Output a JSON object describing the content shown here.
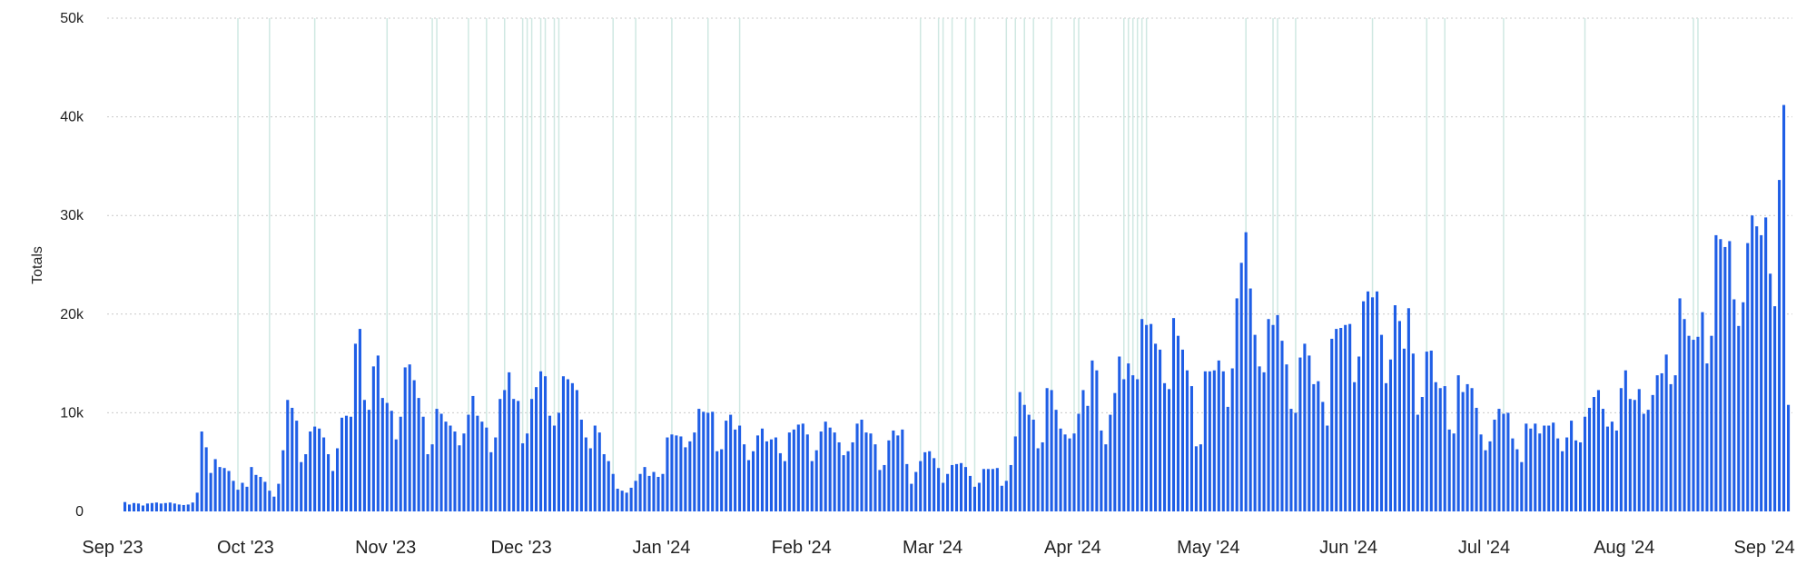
{
  "chart_data": {
    "type": "bar",
    "title": "",
    "xlabel": "",
    "ylabel": "Totals",
    "ylim": [
      0,
      50000
    ],
    "grid": true,
    "bar_color": "#1f5ee6",
    "event_line_color": "#cfe8e2",
    "y_ticks": [
      {
        "value": 0,
        "label": "0"
      },
      {
        "value": 10000,
        "label": "10k"
      },
      {
        "value": 20000,
        "label": "20k"
      },
      {
        "value": 30000,
        "label": "30k"
      },
      {
        "value": 40000,
        "label": "40k"
      },
      {
        "value": 50000,
        "label": "50k"
      }
    ],
    "x_ticks": [
      {
        "date": "2023-09-01",
        "label": "Sep '23"
      },
      {
        "date": "2023-10-01",
        "label": "Oct '23"
      },
      {
        "date": "2023-11-01",
        "label": "Nov '23"
      },
      {
        "date": "2023-12-01",
        "label": "Dec '23"
      },
      {
        "date": "2024-01-01",
        "label": "Jan '24"
      },
      {
        "date": "2024-02-01",
        "label": "Feb '24"
      },
      {
        "date": "2024-03-01",
        "label": "Mar '24"
      },
      {
        "date": "2024-04-01",
        "label": "Apr '24"
      },
      {
        "date": "2024-05-01",
        "label": "May '24"
      },
      {
        "date": "2024-06-01",
        "label": "Jun '24"
      },
      {
        "date": "2024-07-01",
        "label": "Jul '24"
      },
      {
        "date": "2024-08-01",
        "label": "Aug '24"
      },
      {
        "date": "2024-09-01",
        "label": "Sep '24"
      }
    ],
    "event_dates": [
      "2023-09-29",
      "2023-10-06",
      "2023-10-16",
      "2023-11-01",
      "2023-11-11",
      "2023-11-12",
      "2023-11-19",
      "2023-11-23",
      "2023-11-27",
      "2023-12-01",
      "2023-12-02",
      "2023-12-03",
      "2023-12-05",
      "2023-12-06",
      "2023-12-08",
      "2023-12-09",
      "2023-12-21",
      "2023-12-26",
      "2024-01-03",
      "2024-01-11",
      "2024-01-18",
      "2024-02-27",
      "2024-03-02",
      "2024-03-03",
      "2024-03-05",
      "2024-03-08",
      "2024-03-10",
      "2024-03-17",
      "2024-03-19",
      "2024-03-21",
      "2024-03-23",
      "2024-03-27",
      "2024-04-01",
      "2024-04-02",
      "2024-04-12",
      "2024-04-13",
      "2024-04-14",
      "2024-04-15",
      "2024-04-16",
      "2024-04-17",
      "2024-05-09",
      "2024-05-15",
      "2024-05-16",
      "2024-05-20",
      "2024-06-06",
      "2024-06-18",
      "2024-06-22",
      "2024-07-05",
      "2024-07-23",
      "2024-08-16",
      "2024-08-17"
    ],
    "series": [
      {
        "start": "2023-09-04",
        "values": [
          950,
          700,
          850,
          800,
          600,
          800,
          850,
          900,
          800,
          850,
          900,
          800,
          700,
          650,
          700,
          900,
          1900,
          8100,
          6500,
          3900,
          5300,
          4500,
          4400,
          4100,
          3100,
          2200,
          2900,
          2500,
          4500,
          3700,
          3500,
          3000,
          2100,
          1500,
          2800,
          6200,
          11300,
          10500,
          9200,
          5000,
          5800,
          8100,
          8600,
          8400,
          7500,
          5800,
          4100,
          6400,
          9500,
          9700,
          9600,
          17000,
          18500,
          11300,
          10300,
          14700,
          15800,
          11500,
          11000,
          10200,
          7300,
          9600,
          14600,
          14900,
          13300,
          11500,
          9600,
          5800,
          6800,
          10400,
          9900,
          9100,
          8700,
          8100,
          6700,
          7900,
          9800,
          11700,
          9700,
          9100,
          8500,
          6000,
          7500,
          11400,
          12300,
          14100,
          11400,
          11200,
          6900,
          7900,
          11400,
          12600,
          14200,
          13700,
          9700,
          8700,
          10000,
          13700,
          13400,
          13000,
          12300,
          9300,
          7500,
          6400,
          8700,
          8000,
          5800,
          5100,
          3800,
          2300,
          2100,
          1900,
          2400,
          3100,
          3800,
          4500,
          3600,
          4000,
          3500,
          3800,
          7500,
          7800,
          7700,
          7600,
          6500,
          7100,
          8000,
          10400,
          10100,
          10000,
          10100,
          6100,
          6300,
          9200,
          9800,
          8300,
          8700,
          6800,
          5200,
          6100,
          7700,
          8400,
          7100,
          7300,
          7500,
          5900,
          5100,
          8000,
          8300,
          8800,
          8900,
          7800,
          5100,
          6200,
          8100,
          9100,
          8500,
          8000,
          7000,
          5700,
          6100,
          7000,
          8900,
          9300,
          8000,
          7900,
          6800,
          4200,
          4700,
          7200,
          8200,
          7700,
          8300,
          4800,
          2800,
          4000,
          5100,
          6000,
          6100,
          5400,
          4400,
          2900,
          3800,
          4700,
          4800,
          4900,
          4500,
          3600,
          2500,
          2900,
          4300,
          4300,
          4300,
          4400,
          2600,
          3100,
          4700,
          7600,
          12100,
          10800,
          9800,
          9300,
          6400,
          7000,
          12500,
          12300,
          10300,
          8400,
          7800,
          7400,
          7900,
          9900,
          12300,
          10700,
          15300,
          14300,
          8200,
          6800,
          9800,
          12000,
          15700,
          13400,
          15000,
          13800,
          13400,
          19500,
          18900,
          19000,
          17000,
          16400,
          13000,
          12400,
          19600,
          17800,
          16400,
          14300,
          12700,
          6600,
          6800,
          14200,
          14200,
          14300,
          15300,
          14200,
          10600,
          14500,
          21600,
          25200,
          28300,
          22600,
          17900,
          14700,
          14100,
          19500,
          18900,
          19900,
          17300,
          14900,
          10400,
          10000,
          15600,
          17000,
          15800,
          12900,
          13200,
          11100,
          8700,
          17500,
          18500,
          18600,
          18900,
          19000,
          13100,
          15700,
          21300,
          22300,
          21700,
          22300,
          17900,
          13000,
          15400,
          20900,
          19300,
          16500,
          20600,
          16000,
          9800,
          11600,
          16200,
          16300,
          13100,
          12500,
          12700,
          8300,
          7900,
          13800,
          12100,
          12900,
          12500,
          10500,
          7800,
          6200,
          7100,
          9300,
          10400,
          9900,
          10000,
          7400,
          6300,
          5000,
          8900,
          8400,
          8900,
          7900,
          8700,
          8700,
          9000,
          7400,
          6100,
          7500,
          9200,
          7200,
          7000,
          9600,
          10500,
          11600,
          12300,
          10400,
          8600,
          9100,
          8200,
          12500,
          14300,
          11400,
          11300,
          12400,
          9900,
          10300,
          11800,
          13800,
          14000,
          15900,
          12900,
          13800,
          21600,
          19500,
          17800,
          17400,
          17700,
          20200,
          15000,
          17800,
          28000,
          27600,
          26800,
          27400,
          21500,
          18800,
          21200,
          27200,
          30000,
          28900,
          28000,
          29800,
          24100,
          20800,
          33600,
          41200,
          10800
        ]
      }
    ]
  }
}
